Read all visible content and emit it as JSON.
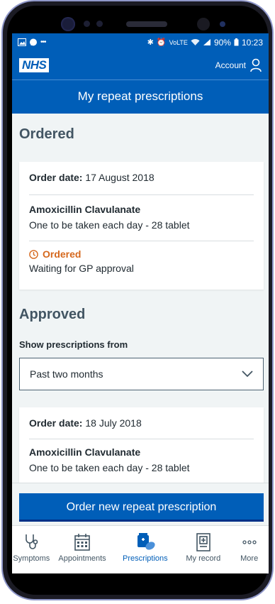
{
  "status_bar": {
    "battery": "90%",
    "time": "10:23",
    "left_icons": [
      "image-icon",
      "message-icon",
      "more-icon"
    ],
    "right_icons": [
      "bluetooth-icon",
      "alarm-icon",
      "volte-icon",
      "wifi-icon",
      "signal-icon",
      "battery-icon"
    ]
  },
  "header": {
    "logo": "NHS",
    "account_label": "Account",
    "title": "My repeat prescriptions"
  },
  "ordered": {
    "heading": "Ordered",
    "order_date_label": "Order date:",
    "order_date": "17 August 2018",
    "medicine": "Amoxicillin Clavulanate",
    "dosage": "One to be taken each day - 28 tablet",
    "status": "Ordered",
    "status_detail": "Waiting for GP approval"
  },
  "approved": {
    "heading": "Approved",
    "filter_label": "Show prescriptions from",
    "filter_value": "Past two months",
    "order_date_label": "Order date:",
    "order_date": "18 July 2018",
    "medicine": "Amoxicillin Clavulanate",
    "dosage": "One to be taken each day - 28 tablet"
  },
  "cta": {
    "label": "Order new repeat prescription"
  },
  "tabs": [
    {
      "label": "Symptoms",
      "icon": "stethoscope-icon"
    },
    {
      "label": "Appointments",
      "icon": "calendar-icon"
    },
    {
      "label": "Prescriptions",
      "icon": "pills-icon",
      "active": true
    },
    {
      "label": "My record",
      "icon": "medical-record-icon"
    },
    {
      "label": "More",
      "icon": "ellipsis-icon"
    }
  ],
  "colors": {
    "brand": "#005eb8",
    "status_ordered": "#d5681d",
    "background": "#f0f4f5"
  }
}
